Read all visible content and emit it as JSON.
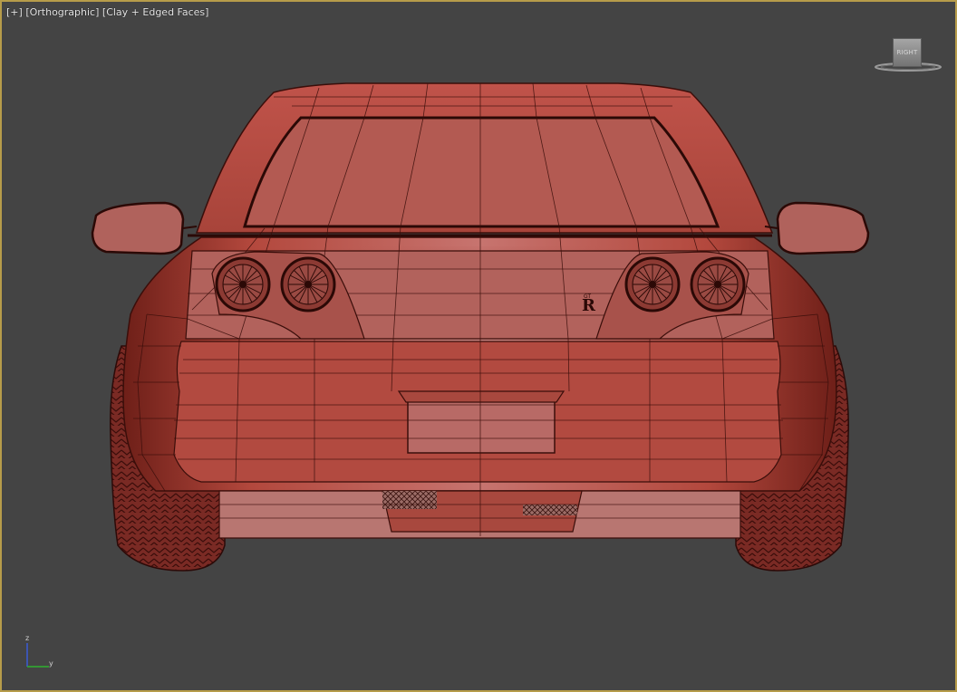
{
  "viewport": {
    "label_plus": "[+]",
    "label_view": "[Orthographic]",
    "label_shading": "[Clay + Edged Faces]",
    "border_color": "#b79c4a",
    "background_color": "#444444"
  },
  "viewcube": {
    "face_label": "RIGHT"
  },
  "model": {
    "badge_text": "R",
    "badge_small": "GT",
    "clay_color": "#b8544a"
  },
  "axis_gizmo": {
    "z_label": "z",
    "y_label": "y"
  }
}
